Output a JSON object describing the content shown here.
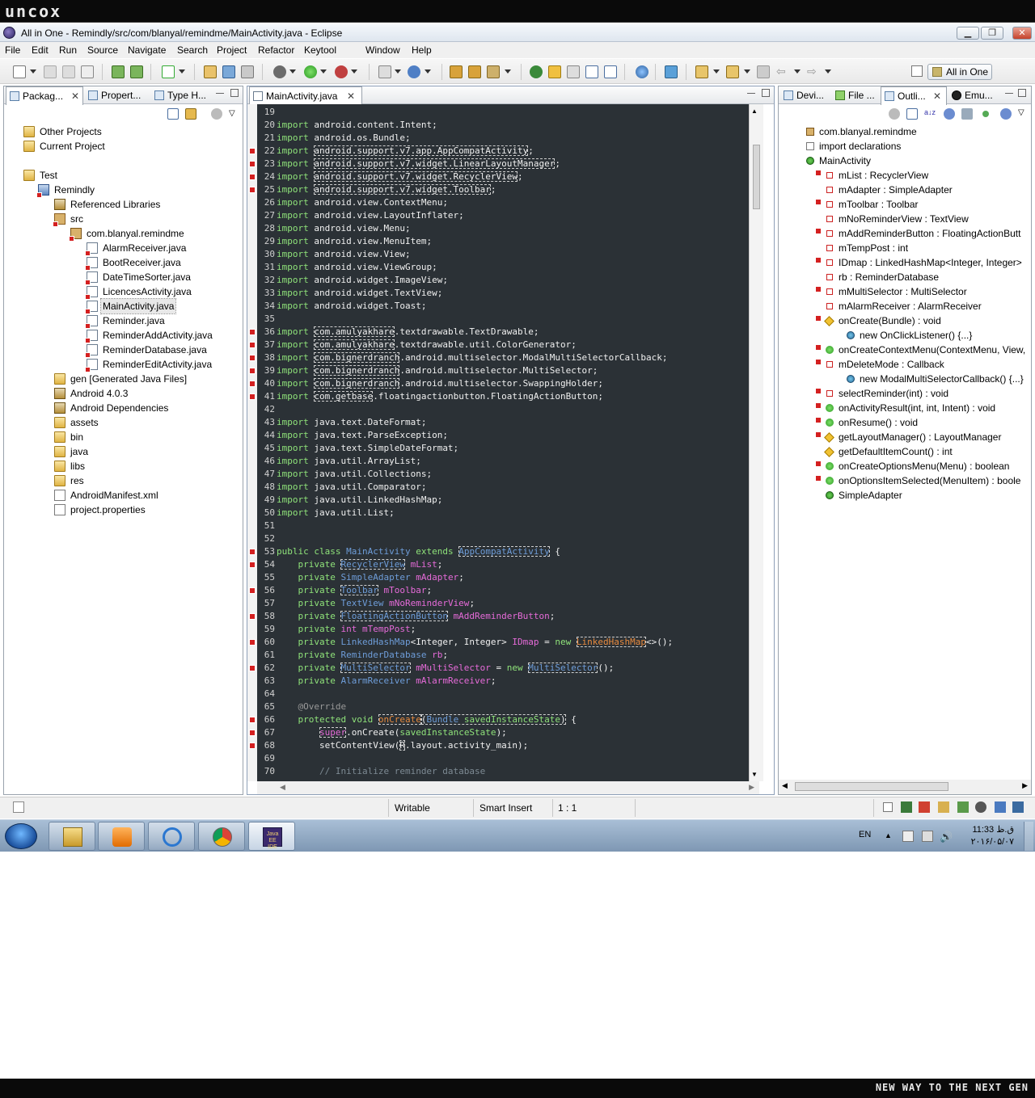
{
  "brand": {
    "logo": "uncox",
    "tagline": "NEW WAY TO THE NEXT GEN"
  },
  "window": {
    "title": "All in One - Remindly/src/com/blanyal/remindme/MainActivity.java - Eclipse"
  },
  "menu": [
    "File",
    "Edit",
    "Run",
    "Source",
    "Navigate",
    "Search",
    "Project",
    "Refactor",
    "Keytool",
    "Window",
    "Help"
  ],
  "perspective": {
    "label": "All in One"
  },
  "left_panel": {
    "tabs": [
      "Packag...",
      "Propert...",
      "Type H..."
    ],
    "tree": [
      {
        "label": "Other Projects",
        "icon": "folder-icon",
        "x": 0
      },
      {
        "label": "Current Project",
        "icon": "folder-icon",
        "x": 0
      },
      {
        "label": "",
        "icon": "",
        "x": 0
      },
      {
        "label": "Test",
        "icon": "folder-icon",
        "x": 0
      },
      {
        "label": "Remindly",
        "icon": "project-icon",
        "x": 1
      },
      {
        "label": "Referenced Libraries",
        "icon": "library-icon",
        "x": 2
      },
      {
        "label": "src",
        "icon": "source-folder-icon",
        "x": 2
      },
      {
        "label": "com.blanyal.remindme",
        "icon": "package-icon",
        "x": 3
      },
      {
        "label": "AlarmReceiver.java",
        "icon": "java-file-icon",
        "x": 4
      },
      {
        "label": "BootReceiver.java",
        "icon": "java-file-icon",
        "x": 4
      },
      {
        "label": "DateTimeSorter.java",
        "icon": "java-file-icon",
        "x": 4
      },
      {
        "label": "LicencesActivity.java",
        "icon": "java-file-icon",
        "x": 4
      },
      {
        "label": "MainActivity.java",
        "icon": "java-file-icon",
        "x": 4,
        "selected": true
      },
      {
        "label": "Reminder.java",
        "icon": "java-file-icon",
        "x": 4
      },
      {
        "label": "ReminderAddActivity.java",
        "icon": "java-file-icon",
        "x": 4
      },
      {
        "label": "ReminderDatabase.java",
        "icon": "java-file-icon",
        "x": 4
      },
      {
        "label": "ReminderEditActivity.java",
        "icon": "java-file-icon",
        "x": 4
      },
      {
        "label": "gen [Generated Java Files]",
        "icon": "folder-icon",
        "x": 2
      },
      {
        "label": "Android 4.0.3",
        "icon": "library-icon",
        "x": 2
      },
      {
        "label": "Android Dependencies",
        "icon": "library-icon",
        "x": 2
      },
      {
        "label": "assets",
        "icon": "folder-icon",
        "x": 2
      },
      {
        "label": "bin",
        "icon": "folder-icon",
        "x": 2
      },
      {
        "label": "java",
        "icon": "folder-icon",
        "x": 2
      },
      {
        "label": "libs",
        "icon": "folder-icon",
        "x": 2
      },
      {
        "label": "res",
        "icon": "folder-icon",
        "x": 2
      },
      {
        "label": "AndroidManifest.xml",
        "icon": "xml-file-icon",
        "x": 2
      },
      {
        "label": "project.properties",
        "icon": "file-icon",
        "x": 2
      }
    ]
  },
  "editor": {
    "tab": "MainActivity.java",
    "lines": [
      {
        "n": "19",
        "t": ""
      },
      {
        "n": "20",
        "t": "<span class=k>import</span> android.content.Intent;"
      },
      {
        "n": "21",
        "t": "<span class=k>import</span> android.os.Bundle;"
      },
      {
        "n": "22",
        "t": "<span class=k>import</span> <span class=u>android.support.v7.app.AppCompatActivity</span>;",
        "e": 1
      },
      {
        "n": "23",
        "t": "<span class=k>import</span> <span class=u>android.support.v7.widget.LinearLayoutManager</span>;",
        "e": 1
      },
      {
        "n": "24",
        "t": "<span class=k>import</span> <span class=u>android.support.v7.widget.RecyclerView</span>;",
        "e": 1
      },
      {
        "n": "25",
        "t": "<span class=k>import</span> <span class=u>android.support.v7.widget.Toolbar</span>;",
        "e": 1
      },
      {
        "n": "26",
        "t": "<span class=k>import</span> android.view.ContextMenu;"
      },
      {
        "n": "27",
        "t": "<span class=k>import</span> android.view.LayoutInflater;"
      },
      {
        "n": "28",
        "t": "<span class=k>import</span> android.view.Menu;"
      },
      {
        "n": "29",
        "t": "<span class=k>import</span> android.view.MenuItem;"
      },
      {
        "n": "30",
        "t": "<span class=k>import</span> android.view.View;"
      },
      {
        "n": "31",
        "t": "<span class=k>import</span> android.view.ViewGroup;"
      },
      {
        "n": "32",
        "t": "<span class=k>import</span> android.widget.ImageView;"
      },
      {
        "n": "33",
        "t": "<span class=k>import</span> android.widget.TextView;"
      },
      {
        "n": "34",
        "t": "<span class=k>import</span> android.widget.Toast;"
      },
      {
        "n": "35",
        "t": ""
      },
      {
        "n": "36",
        "t": "<span class=k>import</span> <span class=u>com.amulyakhare</span>.textdrawable.TextDrawable;",
        "e": 1
      },
      {
        "n": "37",
        "t": "<span class=k>import</span> <span class=u>com.amulyakhare</span>.textdrawable.util.ColorGenerator;",
        "e": 1
      },
      {
        "n": "38",
        "t": "<span class=k>import</span> <span class=u>com.bignerdranch</span>.android.multiselector.ModalMultiSelectorCallback;",
        "e": 1
      },
      {
        "n": "39",
        "t": "<span class=k>import</span> <span class=u>com.bignerdranch</span>.android.multiselector.MultiSelector;",
        "e": 1
      },
      {
        "n": "40",
        "t": "<span class=k>import</span> <span class=u>com.bignerdranch</span>.android.multiselector.SwappingHolder;",
        "e": 1
      },
      {
        "n": "41",
        "t": "<span class=k>import</span> <span class=u>com.getbase</span>.floatingactionbutton.FloatingActionButton;",
        "e": 1
      },
      {
        "n": "42",
        "t": ""
      },
      {
        "n": "43",
        "t": "<span class=k>import</span> java.text.DateFormat;"
      },
      {
        "n": "44",
        "t": "<span class=k>import</span> java.text.ParseException;"
      },
      {
        "n": "45",
        "t": "<span class=k>import</span> java.text.SimpleDateFormat;"
      },
      {
        "n": "46",
        "t": "<span class=k>import</span> java.util.ArrayList;"
      },
      {
        "n": "47",
        "t": "<span class=k>import</span> java.util.Collections;"
      },
      {
        "n": "48",
        "t": "<span class=k>import</span> java.util.Comparator;"
      },
      {
        "n": "49",
        "t": "<span class=k>import</span> java.util.LinkedHashMap;"
      },
      {
        "n": "50",
        "t": "<span class=k>import</span> java.util.List;"
      },
      {
        "n": "51",
        "t": ""
      },
      {
        "n": "52",
        "t": ""
      },
      {
        "n": "53",
        "t": "<span class=k>public class</span> <span class=ty>MainActivity</span> <span class=k>extends</span> <span class='ty u'>AppCompatActivity</span> {",
        "e": 1
      },
      {
        "n": "54",
        "t": "    <span class=k>private</span> <span class='ty u'>RecyclerView</span> <span class=f>mList</span>;",
        "e": 1
      },
      {
        "n": "55",
        "t": "    <span class=k>private</span> <span class=ty>SimpleAdapter</span> <span class=f>mAdapter</span>;"
      },
      {
        "n": "56",
        "t": "    <span class=k>private</span> <span class='ty u'>Toolbar</span> <span class=f>mToolbar</span>;",
        "e": 1
      },
      {
        "n": "57",
        "t": "    <span class=k>private</span> <span class=ty>TextView</span> <span class=f>mNoReminderView</span>;"
      },
      {
        "n": "58",
        "t": "    <span class=k>private</span> <span class='ty u'>FloatingActionButton</span> <span class=f>mAddReminderButton</span>;",
        "e": 1
      },
      {
        "n": "59",
        "t": "    <span class=k>private</span> <span class=f>int</span> <span class=f>mTempPost</span>;"
      },
      {
        "n": "60",
        "t": "    <span class=k>private</span> <span class=ty>LinkedHashMap</span>&lt;Integer, Integer&gt; <span class=f>IDmap</span> = <span class=k>new</span> <span class='m u'>LinkedHashMap</span>&lt;&gt;();",
        "e": 1
      },
      {
        "n": "61",
        "t": "    <span class=k>private</span> <span class=ty>ReminderDatabase</span> <span class=f>rb</span>;"
      },
      {
        "n": "62",
        "t": "    <span class=k>private</span> <span class='ty u'>MultiSelector</span> <span class=f>mMultiSelector</span> = <span class=k>new</span> <span class='ty u'>MultiSelector</span>();",
        "e": 1
      },
      {
        "n": "63",
        "t": "    <span class=k>private</span> <span class=ty>AlarmReceiver</span> <span class=f>mAlarmReceiver</span>;"
      },
      {
        "n": "64",
        "t": ""
      },
      {
        "n": "65",
        "t": "    <span class=a>@Override</span>"
      },
      {
        "n": "66",
        "t": "    <span class=k>protected void</span> <span class='m u'>onCreate</span><span class=u>(<span class=ty>Bundle</span> <span class=k>savedInstanceState</span>)</span> {",
        "e": 1
      },
      {
        "n": "67",
        "t": "        <span class='f u'>super</span>.onCreate(<span class=k>savedInstanceState</span>);",
        "e": 1
      },
      {
        "n": "68",
        "t": "        setContentView(<span class=u>R</span>.layout.activity_main);",
        "e": 1
      },
      {
        "n": "69",
        "t": ""
      },
      {
        "n": "70",
        "t": "        <span class=c>// Initialize reminder database</span>"
      }
    ]
  },
  "right_panel": {
    "tabs": [
      "Devi...",
      "File ...",
      "Outli...",
      "Emu..."
    ],
    "outline": [
      {
        "label": "com.blanyal.remindme",
        "icon": "package-icon",
        "x": 0
      },
      {
        "label": "import declarations",
        "icon": "imports-icon",
        "x": 0
      },
      {
        "label": "MainActivity",
        "icon": "class-icon",
        "x": 0
      },
      {
        "label": "mList : RecyclerView",
        "icon": "private-field-icon",
        "x": 1,
        "e": 1
      },
      {
        "label": "mAdapter : SimpleAdapter",
        "icon": "private-field-icon",
        "x": 1
      },
      {
        "label": "mToolbar : Toolbar",
        "icon": "private-field-icon",
        "x": 1,
        "e": 1
      },
      {
        "label": "mNoReminderView : TextView",
        "icon": "private-field-icon",
        "x": 1
      },
      {
        "label": "mAddReminderButton : FloatingActionButt",
        "icon": "private-field-icon",
        "x": 1,
        "e": 1
      },
      {
        "label": "mTempPost : int",
        "icon": "private-field-icon",
        "x": 1
      },
      {
        "label": "IDmap : LinkedHashMap<Integer, Integer>",
        "icon": "private-field-icon",
        "x": 1,
        "e": 1
      },
      {
        "label": "rb : ReminderDatabase",
        "icon": "private-field-icon",
        "x": 1
      },
      {
        "label": "mMultiSelector : MultiSelector",
        "icon": "private-field-icon",
        "x": 1,
        "e": 1
      },
      {
        "label": "mAlarmReceiver : AlarmReceiver",
        "icon": "private-field-icon",
        "x": 1
      },
      {
        "label": "onCreate(Bundle) : void",
        "icon": "protected-method-icon",
        "x": 1,
        "e": 1
      },
      {
        "label": "new OnClickListener() {...}",
        "icon": "anonymous-class-icon",
        "x": 2
      },
      {
        "label": "onCreateContextMenu(ContextMenu, View,",
        "icon": "public-method-icon",
        "x": 1,
        "e": 1
      },
      {
        "label": "mDeleteMode : Callback",
        "icon": "private-field-icon",
        "x": 1,
        "e": 1
      },
      {
        "label": "new ModalMultiSelectorCallback() {...}",
        "icon": "anonymous-class-icon",
        "x": 2
      },
      {
        "label": "selectReminder(int) : void",
        "icon": "private-method-icon",
        "x": 1,
        "e": 1
      },
      {
        "label": "onActivityResult(int, int, Intent) : void",
        "icon": "public-method-icon",
        "x": 1,
        "e": 1
      },
      {
        "label": "onResume() : void",
        "icon": "public-method-icon",
        "x": 1,
        "e": 1
      },
      {
        "label": "getLayoutManager() : LayoutManager",
        "icon": "protected-method-icon",
        "x": 1,
        "e": 1
      },
      {
        "label": "getDefaultItemCount() : int",
        "icon": "protected-method-icon",
        "x": 1
      },
      {
        "label": "onCreateOptionsMenu(Menu) : boolean",
        "icon": "public-method-icon",
        "x": 1,
        "e": 1
      },
      {
        "label": "onOptionsItemSelected(MenuItem) : boole",
        "icon": "public-method-icon",
        "x": 1,
        "e": 1
      },
      {
        "label": "SimpleAdapter",
        "icon": "class-icon",
        "x": 1
      }
    ]
  },
  "status": {
    "writable": "Writable",
    "insert": "Smart Insert",
    "position": "1 : 1"
  },
  "taskbar": {
    "lang": "EN",
    "time": "11:33 ق.ظ",
    "date": "۲۰۱۶/۰۵/۰۷",
    "java_label": "Java EE IDE"
  },
  "colors": {
    "editor_bg": "#2b3136",
    "keyword": "#8fe37a",
    "type": "#6e9dd9",
    "field": "#e66bd9",
    "method": "#e78a3e"
  }
}
